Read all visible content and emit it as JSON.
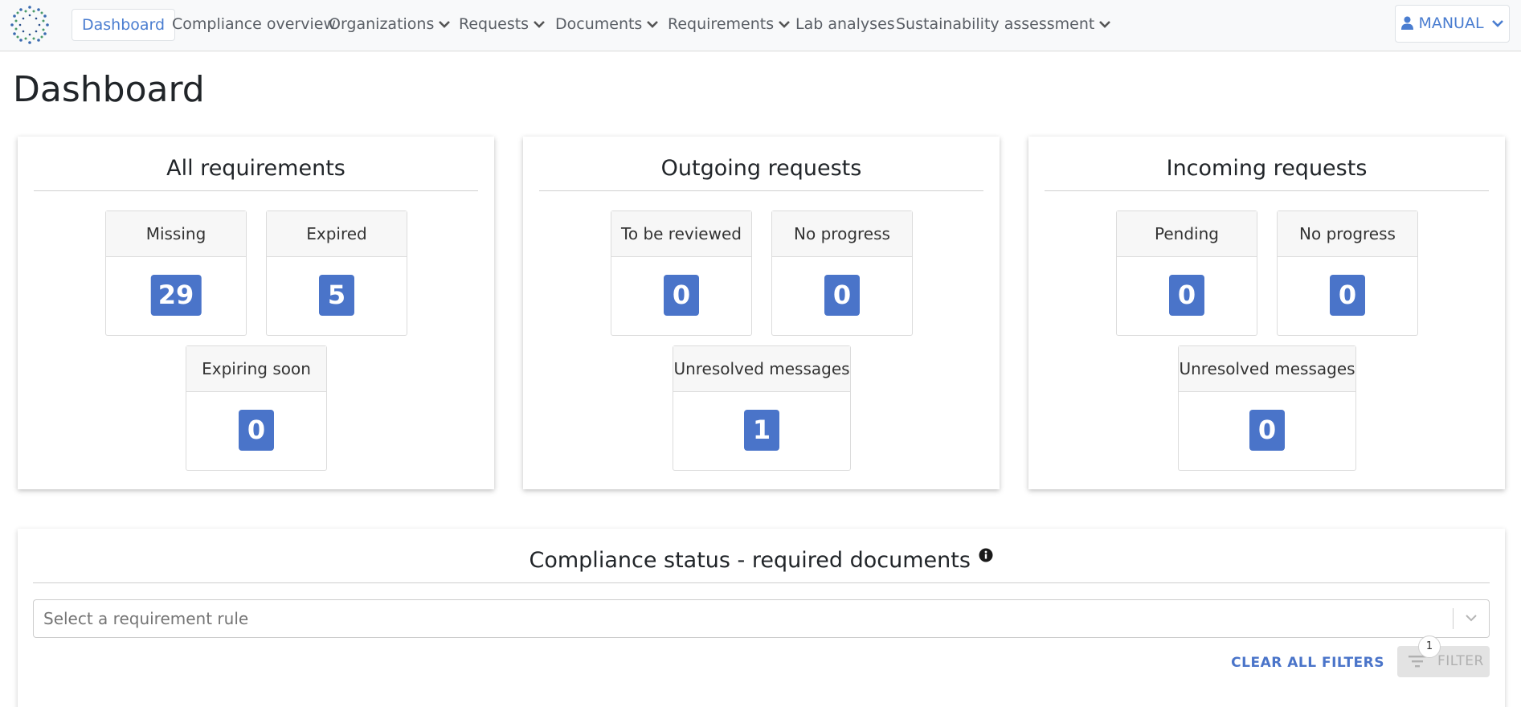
{
  "nav": {
    "items": [
      {
        "label": "Dashboard"
      },
      {
        "label": "Compliance overview"
      },
      {
        "label": "Organizations"
      },
      {
        "label": "Requests"
      },
      {
        "label": "Documents"
      },
      {
        "label": "Requirements"
      },
      {
        "label": "Lab analyses"
      },
      {
        "label": "Sustainability assessment"
      }
    ],
    "user_label": "MANUAL"
  },
  "page_title": "Dashboard",
  "cards": [
    {
      "title": "All requirements",
      "stats": [
        {
          "label": "Missing",
          "value": "29"
        },
        {
          "label": "Expired",
          "value": "5"
        },
        {
          "label": "Expiring soon",
          "value": "0"
        }
      ]
    },
    {
      "title": "Outgoing requests",
      "stats": [
        {
          "label": "To be reviewed",
          "value": "0"
        },
        {
          "label": "No progress",
          "value": "0"
        },
        {
          "label": "Unresolved messages",
          "value": "1"
        }
      ]
    },
    {
      "title": "Incoming requests",
      "stats": [
        {
          "label": "Pending",
          "value": "0"
        },
        {
          "label": "No progress",
          "value": "0"
        },
        {
          "label": "Unresolved messages",
          "value": "0"
        }
      ]
    }
  ],
  "compliance": {
    "title": "Compliance status - required documents",
    "select_placeholder": "Select a requirement rule",
    "clear_filters": "CLEAR ALL FILTERS",
    "filter_label": "FILTER",
    "filter_count": "1"
  },
  "colors": {
    "accent": "#4a74c9",
    "nav_active": "#4a7dd0"
  }
}
